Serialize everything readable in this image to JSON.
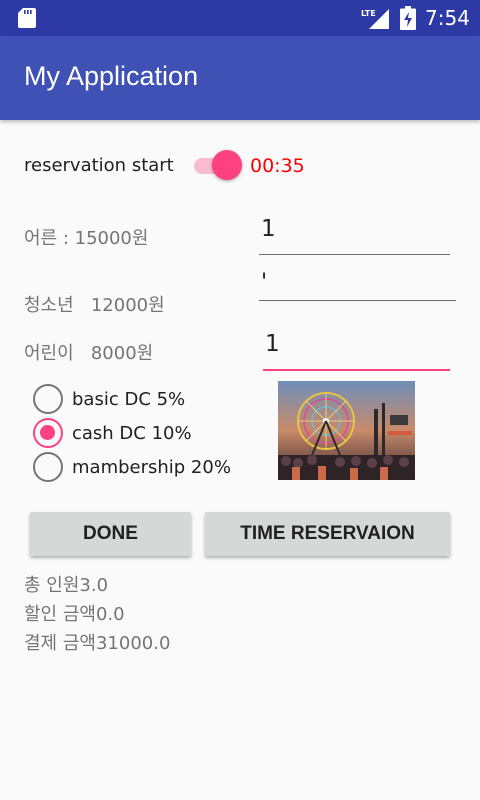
{
  "status": {
    "time": "7:54",
    "network": "LTE"
  },
  "app": {
    "title": "My Application"
  },
  "reservation": {
    "label": "reservation start",
    "switch_on": true,
    "timer": "00:35"
  },
  "prices": [
    {
      "label": "어른 : 15000원",
      "value": "1"
    },
    {
      "label": "청소년   12000원",
      "value": "'"
    },
    {
      "label": "어린이   8000원",
      "value": "1"
    }
  ],
  "discounts": [
    {
      "label": "basic DC 5%",
      "checked": false
    },
    {
      "label": "cash DC 10%",
      "checked": true
    },
    {
      "label": "mambership 20%",
      "checked": false
    }
  ],
  "photo": {
    "icon": "ferris-wheel-image"
  },
  "buttons": {
    "done": "DONE",
    "time_reservation": "TIME RESERVAION"
  },
  "summary": {
    "total_people": "총 인원3.0",
    "discount_amount": "할인 금액0.0",
    "payment_amount": "결제 금액31000.0"
  },
  "colors": {
    "primary": "#3f51b5",
    "primary_dark": "#2d3aa6",
    "accent": "#ff4081",
    "timer": "#ff0000"
  }
}
